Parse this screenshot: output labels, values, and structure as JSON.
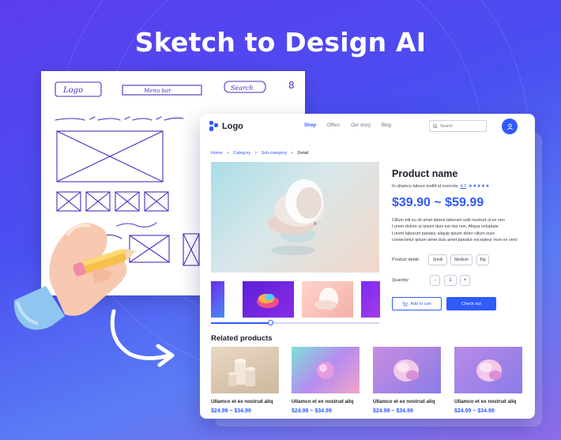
{
  "headline": "Sketch to Design AI",
  "sketch": {
    "logo_label": "Logo",
    "menu_label": "Menu bar",
    "search_label": "Search",
    "account_glyph": "8"
  },
  "design": {
    "logo_text": "Logo",
    "menu": [
      {
        "label": "Shop",
        "active": true
      },
      {
        "label": "Offers"
      },
      {
        "label": "Our story"
      },
      {
        "label": "Blog"
      }
    ],
    "search_placeholder": "Search",
    "breadcrumb": [
      "Home",
      "Category",
      "Sub-category",
      "Detail"
    ],
    "breadcrumb_sep": ">",
    "product": {
      "name": "Product name",
      "tagline": "In ullamco labore mollit et exercita",
      "rating": "4.7",
      "stars": "★★★★★",
      "price": "$39.90 ~ $59.99",
      "description": [
        "Cillum elit eu sit amet labore laborum velit nostrud ut ex non",
        "Lorem dolore ut ipsum duis est nisi non. Aliqua voluptate",
        "Lorem laborum pariatur aliquip ipsum dolor cillum irure",
        "consectetur ipsum amet duis amet pariatur excepteur irure ex vero"
      ],
      "detail_label": "Product detail:",
      "sizes": [
        "Small",
        "Medium",
        "Big"
      ],
      "quantity_label": "Quantity:",
      "qty_minus": "-",
      "qty_value": "1",
      "qty_plus": "+",
      "add_to_cart": "Add to cart",
      "checkout": "Check out",
      "gallery_progress": 0.35
    },
    "related_title": "Related products",
    "related": [
      {
        "name": "Ullamco et ex nostrud aliq",
        "price": "$24.99 ~ $34.99"
      },
      {
        "name": "Ullamco et ex nostrud aliq",
        "price": "$24.99 ~ $34.99"
      },
      {
        "name": "Ullamco et ex nostrud aliq",
        "price": "$24.99 ~ $34.99"
      },
      {
        "name": "Ullamco et ex nostrud aliq",
        "price": "$24.99 ~ $34.99"
      }
    ]
  },
  "colors": {
    "accent": "#2f5bff",
    "sketch_ink": "#4a2fc0",
    "background": "#5b3df0"
  }
}
